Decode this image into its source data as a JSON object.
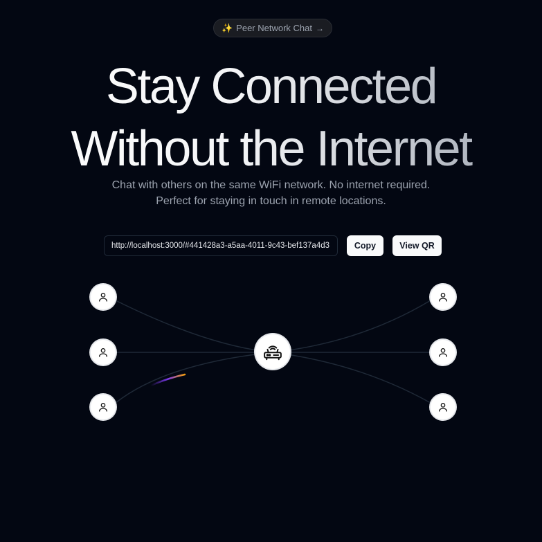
{
  "badge": {
    "icon": "sparkle-icon",
    "label": "Peer Network Chat",
    "arrow_icon": "arrow-right-icon"
  },
  "hero": {
    "title_line1": "Stay Connected",
    "title_line2": "Without the Internet",
    "subtitle_line1": "Chat with others on the same WiFi network. No internet required.",
    "subtitle_line2": "Perfect for staying in touch in remote locations."
  },
  "share": {
    "url": "http://localhost:3000/#441428a3-a5aa-4011-9c43-bef137a4d3",
    "copy_label": "Copy",
    "qr_label": "View QR"
  },
  "network": {
    "hub_icon": "router-icon",
    "peer_icon": "user-icon",
    "peers": [
      "left-top",
      "left-middle",
      "left-bottom",
      "right-top",
      "right-middle",
      "right-bottom"
    ]
  },
  "colors": {
    "background": "#030712",
    "line": "#1f2937",
    "beam_start": "#7c3aed",
    "beam_end": "#f59e0b"
  }
}
